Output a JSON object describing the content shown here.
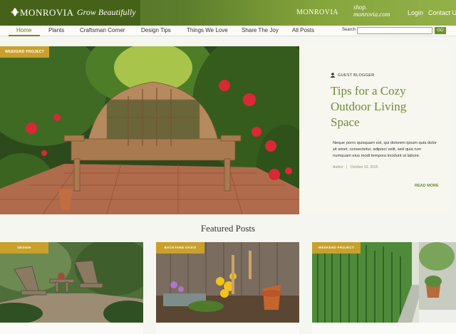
{
  "header": {
    "brand": "MONROVIA",
    "tagline": "Grow Beautifully",
    "monrovia_link": "MONROVIA",
    "shop_line1": "shop.",
    "shop_line2": "monrovia.com",
    "login": "Login",
    "contact": "Contact Us"
  },
  "nav": {
    "items": [
      "Home",
      "Plants",
      "Craftsman Corner",
      "Design Tips",
      "Things We Love",
      "Share The Joy",
      "All Posts"
    ],
    "search_label": "Search",
    "search_value": "",
    "search_button": "GO"
  },
  "hero": {
    "tag": "WEEKEND PROJECT",
    "author_label": "GUEST BLOGGER",
    "title": "Tips for a Cozy Outdoor Living Space",
    "body": "Neque porro quisquam est, qui dolorem ipsum quia dolor sit amet, consectetur, adipisci velit, sed quia non numquam eius modi tempora incidunt ut labore.",
    "author": "Author",
    "separator": "|",
    "date": "October 19, 2015",
    "read_more": "READ MORE"
  },
  "featured": {
    "title": "Featured Posts",
    "cards": [
      {
        "tag": "DESIGN"
      },
      {
        "tag": "BACKYARD OASIS"
      },
      {
        "tag": "WEEKEND PROJECT"
      }
    ]
  },
  "colors": {
    "brand_green": "#456218",
    "accent_green": "#6f8a3a",
    "tag_gold": "#c9a02b"
  }
}
